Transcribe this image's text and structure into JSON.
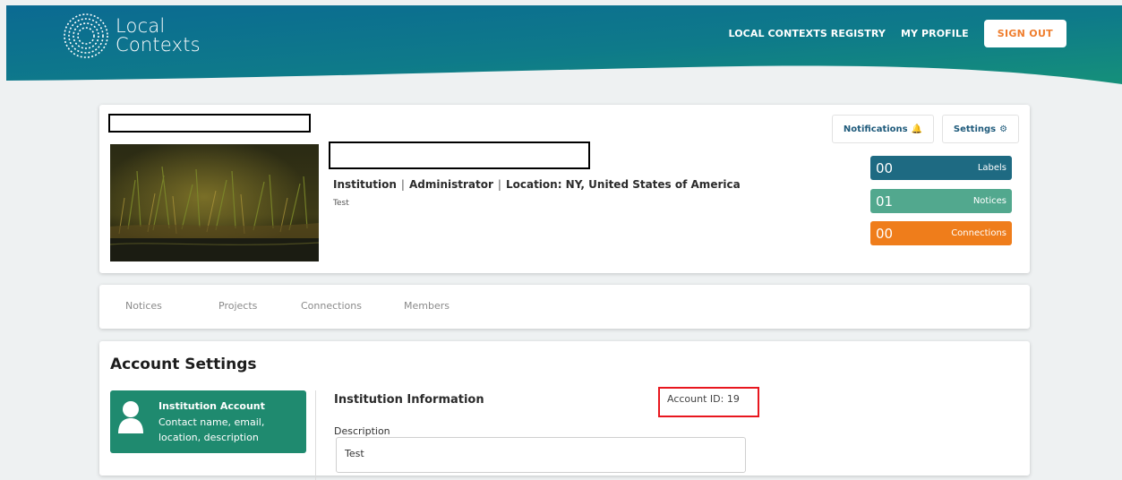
{
  "header": {
    "logo_line1": "Local",
    "logo_line2": "Contexts",
    "nav_registry": "LOCAL CONTEXTS REGISTRY",
    "nav_profile": "MY PROFILE",
    "signout": "SIGN OUT"
  },
  "profile": {
    "meta": {
      "type": "Institution",
      "role": "Administrator",
      "location": "Location: NY, United States of America",
      "separator": "|"
    },
    "description": "Test",
    "notifications_label": "Notifications",
    "settings_label": "Settings",
    "stats": [
      {
        "count": "00",
        "label": "Labels",
        "color": "#1e6a82"
      },
      {
        "count": "01",
        "label": "Notices",
        "color": "#52a88e"
      },
      {
        "count": "00",
        "label": "Connections",
        "color": "#ef7d1b"
      }
    ]
  },
  "tabs": [
    {
      "label": "Notices"
    },
    {
      "label": "Projects"
    },
    {
      "label": "Connections"
    },
    {
      "label": "Members"
    }
  ],
  "account": {
    "title": "Account Settings",
    "panel_title": "Institution Account",
    "panel_sub": "Contact name, email, location, description",
    "info_title": "Institution Information",
    "account_id": "Account ID: 19",
    "description_label": "Description",
    "description_value": "Test"
  },
  "colors": {
    "header_gradient_start": "#0b6f93",
    "header_gradient_end": "#138a78",
    "accent_orange": "#ef7d2d",
    "panel_green": "#1f8a6f",
    "highlight_red": "#e8171f"
  }
}
